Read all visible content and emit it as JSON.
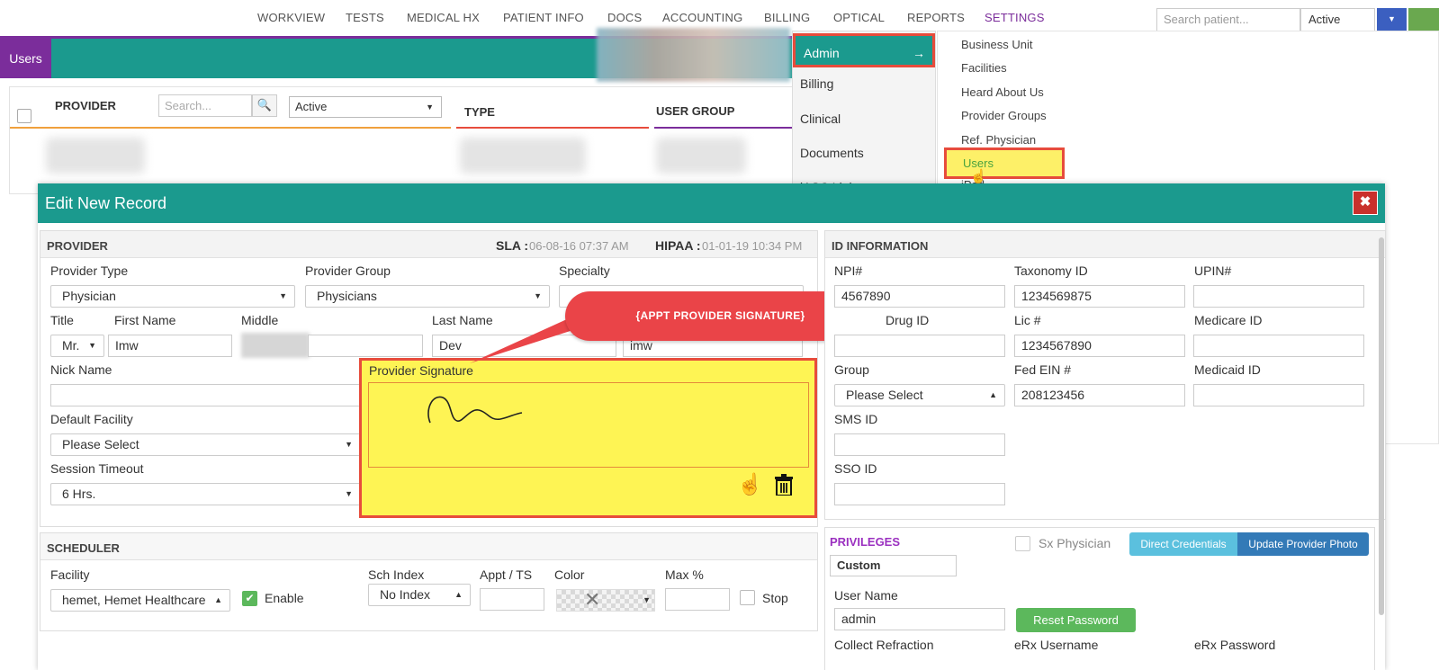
{
  "nav": {
    "items": [
      "WORKVIEW",
      "TESTS",
      "MEDICAL HX",
      "PATIENT INFO",
      "DOCS",
      "ACCOUNTING",
      "BILLING",
      "OPTICAL",
      "REPORTS",
      "SETTINGS"
    ],
    "search_placeholder": "Search patient...",
    "status": "Active",
    "accent_color": "#7b2d9b"
  },
  "page": {
    "tab_label": "Users",
    "theme_color": "#1b9a8e"
  },
  "table": {
    "provider_header": "PROVIDER",
    "search_placeholder": "Search...",
    "status_value": "Active",
    "type_header": "TYPE",
    "user_group_header": "USER GROUP"
  },
  "settings_menu": {
    "items": [
      "Admin",
      "Billing",
      "Clinical",
      "Documents",
      "iASC Link"
    ],
    "submenu": [
      "Business Unit",
      "Facilities",
      "Heard About Us",
      "Provider Groups",
      "Ref. Physician",
      "Users",
      "iPad"
    ]
  },
  "modal": {
    "title": "Edit New Record",
    "close_label": "✖",
    "provider": {
      "title": "PROVIDER",
      "sla_label": "SLA :",
      "sla_value": "06-08-16 07:37 AM",
      "hipaa_label": "HIPAA :",
      "hipaa_value": "01-01-19 10:34 PM",
      "provider_type_label": "Provider Type",
      "provider_type": "Physician",
      "provider_group_label": "Provider Group",
      "provider_group": "Physicians",
      "specialty_label": "Specialty",
      "title_label": "Title",
      "title_value": "Mr.",
      "first_name_label": "First Name",
      "first_name": "Imw",
      "middle_label": "Middle",
      "last_name_label": "Last Name",
      "last_name": "Dev",
      "initials_value": "imw",
      "nick_name_label": "Nick Name",
      "default_facility_label": "Default Facility",
      "default_facility": "Please Select",
      "session_timeout_label": "Session Timeout",
      "session_timeout": "6 Hrs.",
      "signature_label": "Provider Signature",
      "callout": "{APPT PROVIDER SIGNATURE}"
    },
    "id_info": {
      "title": "ID INFORMATION",
      "npi_label": "NPI#",
      "npi": "4567890",
      "taxonomy_label": "Taxonomy ID",
      "taxonomy": "1234569875",
      "upin_label": "UPIN#",
      "drug_label": "Drug ID",
      "lic_label": "Lic #",
      "lic": "1234567890",
      "medicare_label": "Medicare ID",
      "group_label": "Group",
      "group": "Please Select",
      "fed_ein_label": "Fed EIN #",
      "fed_ein": "208123456",
      "medicaid_label": "Medicaid ID",
      "sms_label": "SMS ID",
      "sso_label": "SSO ID"
    },
    "scheduler": {
      "title": "SCHEDULER",
      "facility_label": "Facility",
      "facility": "hemet, Hemet Healthcare",
      "enable_label": "Enable",
      "sch_index_label": "Sch Index",
      "sch_index": "No Index",
      "appt_ts_label": "Appt / TS",
      "color_label": "Color",
      "max_label": "Max %",
      "stop_label": "Stop"
    },
    "privileges": {
      "title": "PRIVILEGES",
      "sx_physician_label": "Sx Physician",
      "direct_credentials": "Direct Credentials",
      "update_photo": "Update Provider Photo",
      "privilege_value": "Custom",
      "user_name_label": "User Name",
      "user_name": "admin",
      "reset_password": "Reset Password",
      "collect_refraction_label": "Collect Refraction",
      "erx_username_label": "eRx Username",
      "erx_password_label": "eRx Password"
    }
  }
}
